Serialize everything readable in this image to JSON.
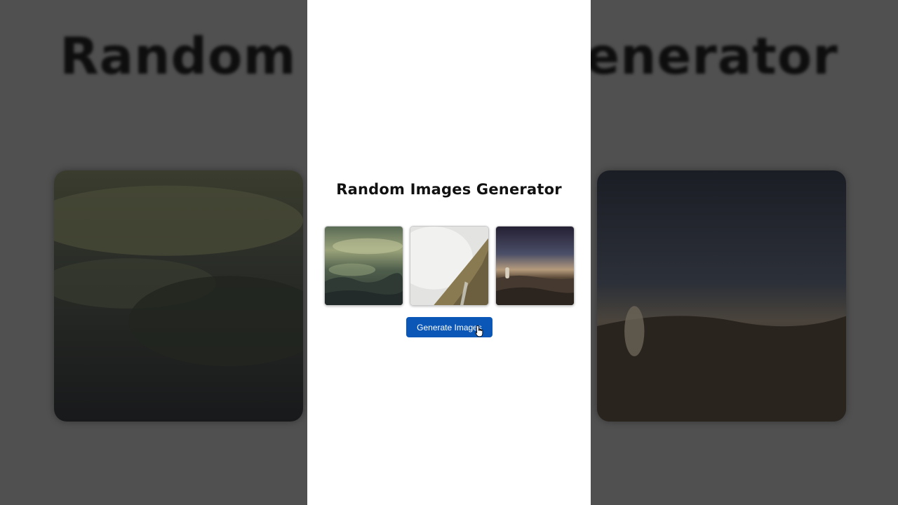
{
  "background": {
    "title": "Random Images Generator"
  },
  "app": {
    "title": "Random Images Generator",
    "generate_button_label": "Generate Images",
    "images": [
      {
        "icon": "misty-forest-image"
      },
      {
        "icon": "foggy-mountain-slope-image"
      },
      {
        "icon": "night-sky-cliff-image"
      }
    ]
  },
  "colors": {
    "button_bg": "#0b57b8",
    "panel_bg": "#ffffff",
    "backdrop": "#505050"
  }
}
